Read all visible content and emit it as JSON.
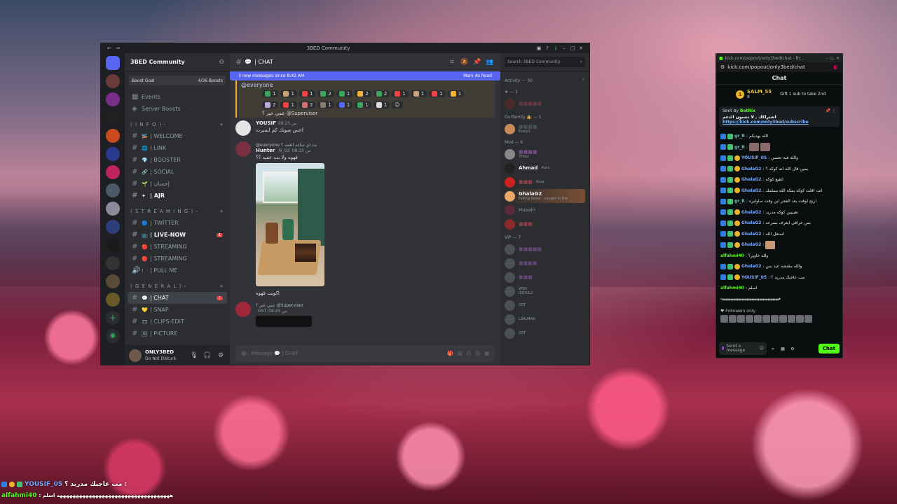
{
  "desktop": {
    "accent": "#c9889c"
  },
  "discord": {
    "window_title": "3BED Community",
    "server_name": "3BED Community",
    "boost_goal": {
      "label": "Boost Goal",
      "value": "4/36 Boosts"
    },
    "nav": [
      {
        "label": "Events",
        "icon": "calendar-icon"
      },
      {
        "label": "Server Boosts",
        "icon": "boost-icon"
      }
    ],
    "categories": {
      "info": "( I N F O ) -",
      "streaming": "( S T R E A M I N G ) -",
      "general": "( G E N E R A L ) -"
    },
    "info_channels": [
      "| WELCOME",
      "| LINK",
      "| BOOSTER",
      "| SOCIAL",
      "| إحسان",
      "| AJR"
    ],
    "streaming_channels": [
      "| TWITTER",
      "| LIVE-NOW",
      "| STREAMING",
      "| STREAMING",
      "| PULL ME"
    ],
    "general_channels": [
      "| CHAT",
      "| SNAP",
      "| CLIPS-EDIT",
      "| PICTURE"
    ],
    "live_now_badge": "1",
    "chat_badge": "1",
    "user": {
      "name": "ONLY3BED",
      "status": "Do Not Disturb"
    },
    "chat_header": "| CHAT",
    "new_messages": {
      "text": "3 new messages since 8:42 AM",
      "action": "Mark As Read"
    },
    "mention_everyone": "@everyone",
    "reactions_row1": [
      "1",
      "1",
      "1",
      "2",
      "1",
      "2",
      "2",
      "1",
      "1",
      "1",
      "1"
    ],
    "reactions_row2": [
      "2",
      "1",
      "2",
      "1",
      "1",
      "1",
      "1"
    ],
    "reply_line": "عمي خير ؟ @Supervisor",
    "messages": [
      {
        "name": "YOUSIF",
        "time": "س 08:25",
        "text": "احس صوتك كم ايمبرت"
      },
      {
        "name": "Hunter",
        "tag": "N_G2",
        "time": "س 08:25",
        "reply": "@everyone بت اي ساعه العمه ؟",
        "text": "قهوه ولا بت عفيد ؟؟",
        "caption": "اكوبت قهوه"
      },
      {
        "reply": "عمي خير ؟ @Supervisor",
        "tag": "OST",
        "time": "س 08:25"
      }
    ],
    "composer_placeholder": "Message 💬 | CHAT",
    "search_placeholder": "Search 3BED Community",
    "activity_label": "Activity — 30",
    "members": {
      "sec_star": "★ — 1",
      "sec_family": "Ourfamily 🔒 — 1",
      "sec_mod": "Mod — 6",
      "sec_vip": "VIP — 7",
      "mod_names": [
        "5Ykez",
        "Ahmad",
        "Aura",
        "GhalaG2",
        "Husain",
        "Aura"
      ],
      "family_name": "Evely3",
      "vip_subs": [
        "R3DUL2",
        "OST",
        "WSH",
        "L3ALMAN",
        "OST"
      ],
      "ghala_sub": "Falling faster , caught in the"
    }
  },
  "kick": {
    "titlebar": "kick.com/popout/only3bed/chat - Br...",
    "url": "kick.com/popout/only3bed/chat",
    "header": "Chat",
    "gift": {
      "name": "SALM_55",
      "count": "8",
      "text": "Gift 1 sub to take 2nd"
    },
    "pinned": {
      "by": "Sent by",
      "bot": "BotRix",
      "title": "اشتراكك , لا تنسون الدعم",
      "link": "https://kick.com/only3bed/subscribe"
    },
    "messages": [
      {
        "user": "gr_R",
        "text": "الله يهديكم",
        "color": "teal"
      },
      {
        "user": "gr_R",
        "text": "",
        "color": "teal"
      },
      {
        "user": "YOUSIF_05",
        "text": "والله فيه تحسن",
        "color": "blue"
      },
      {
        "user": "GhalaG2",
        "text": "يمين قال الله انه كوكه ؟",
        "color": "blue"
      },
      {
        "user": "GhalaG2",
        "text": "اتقيع كوكه",
        "color": "blue"
      },
      {
        "user": "GhalaG2",
        "text": "انت اقلت كوكه بمكه الله يسلمك",
        "color": "blue"
      },
      {
        "user": "gr_R",
        "text": "اربح لوقت بعد الفجر اين وقت ساوليزه",
        "color": "teal"
      },
      {
        "user": "GhalaG2",
        "text": "تعيييين كوكه مدريد",
        "color": "blue"
      },
      {
        "user": "GhalaG2",
        "text": "بس حرافي ايعرف بسرعه",
        "color": "blue"
      },
      {
        "user": "GhalaG2",
        "text": "استغل الله",
        "color": "blue"
      },
      {
        "user": "GhalaG2",
        "text": "",
        "color": "blue"
      },
      {
        "user": "alfahmi40",
        "text": "ولله خاوير؟",
        "color": "green"
      },
      {
        "user": "GhalaG2",
        "text": "والله مقتشه عبد بس",
        "color": "blue"
      },
      {
        "user": "YOUSIF_05",
        "text": "مب عاجبك مدريد ؟",
        "color": "blue"
      },
      {
        "user": "alfahmi40",
        "text": "اسلم",
        "color": "green"
      },
      {
        "user": "",
        "text": "ههههههههههههههههههههههههههههههههههههه",
        "color": "green"
      }
    ],
    "followers_label": "Followers only",
    "input_placeholder": "Send a message",
    "chat_button": "Chat"
  },
  "overlay": {
    "line1_user": "YOUSIF_05",
    "line1_text": "مب عاجبك مدريد ؟ :",
    "line2_user": "alfahmi40",
    "line2_text": ": هههههههههههههههههههههههههههههههههههه اسلم"
  }
}
